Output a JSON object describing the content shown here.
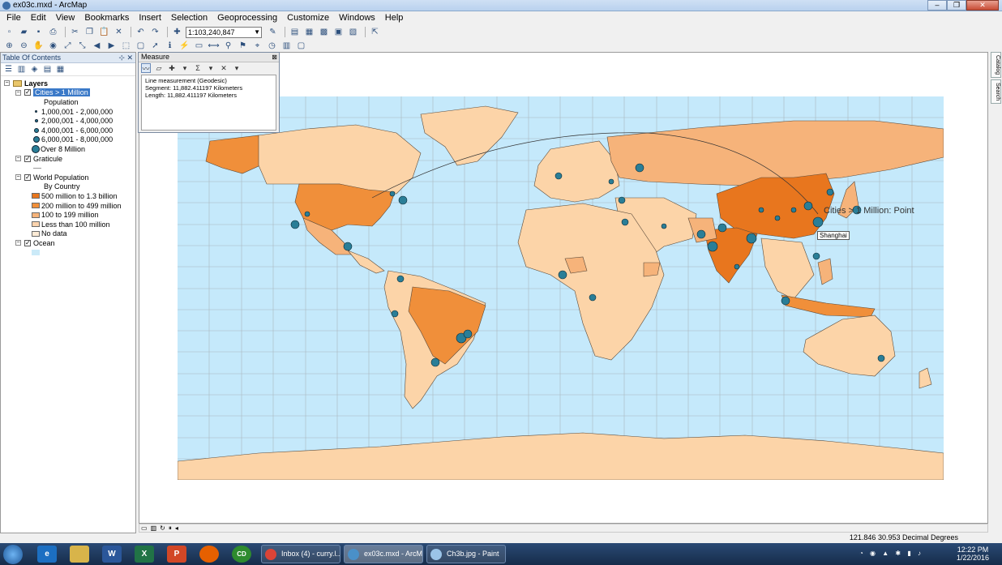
{
  "window": {
    "title": "ex03c.mxd - ArcMap",
    "buttons": [
      "–",
      "❐",
      "✕"
    ]
  },
  "menubar": [
    "File",
    "Edit",
    "View",
    "Bookmarks",
    "Insert",
    "Selection",
    "Geoprocessing",
    "Customize",
    "Windows",
    "Help"
  ],
  "toolbar": {
    "scale": "1:103,240,847"
  },
  "toc": {
    "title": "Table Of Contents",
    "layers_label": "Layers",
    "cities_layer": "Cities > 1 Million",
    "population_label": "Population",
    "city_classes": [
      "1,000,001 - 2,000,000",
      "2,000,001 - 4,000,000",
      "4,000,001 - 6,000,000",
      "6,000,001 - 8,000,000",
      "Over 8 Million"
    ],
    "graticule_layer": "Graticule",
    "world_pop_layer": "World Population",
    "by_country_label": "By Country",
    "country_classes": [
      {
        "label": "500 million to 1.3 billion",
        "color": "#e8761e"
      },
      {
        "label": "200 million to 499 million",
        "color": "#f08f3a"
      },
      {
        "label": "100 to 199 million",
        "color": "#f6b37a"
      },
      {
        "label": "Less than 100 million",
        "color": "#fbd3ad"
      },
      {
        "label": "No data",
        "color": "#fdebd6"
      }
    ],
    "ocean_layer": "Ocean",
    "ocean_color": "#cbeaf8"
  },
  "measure": {
    "title": "Measure",
    "line1": "Line measurement (Geodesic)",
    "line2": "Segment: 11,882.411197 Kilometers",
    "line3": "Length: 11,882.411197 Kilometers"
  },
  "map": {
    "tooltip_layer": "Cities > 1 Million: Point",
    "tooltip_city": "Shanghai",
    "ocean_color": "#c5e9fb",
    "land_colors": {
      "high": "#e8761e",
      "mid": "#f08f3a",
      "low": "#f6b37a",
      "lowest": "#fcd4a8"
    }
  },
  "side_tabs": [
    "Catalog",
    "Search"
  ],
  "status": {
    "coords": "121.846  30.953 Decimal Degrees"
  },
  "taskbar": {
    "apps": [
      "e",
      "W",
      "X",
      "P",
      "CD"
    ],
    "tasks": [
      "Inbox (4) - curry.l...",
      "ex03c.mxd - ArcM...",
      "Ch3b.jpg - Paint"
    ],
    "time": "12:22 PM",
    "date": "1/22/2016"
  }
}
